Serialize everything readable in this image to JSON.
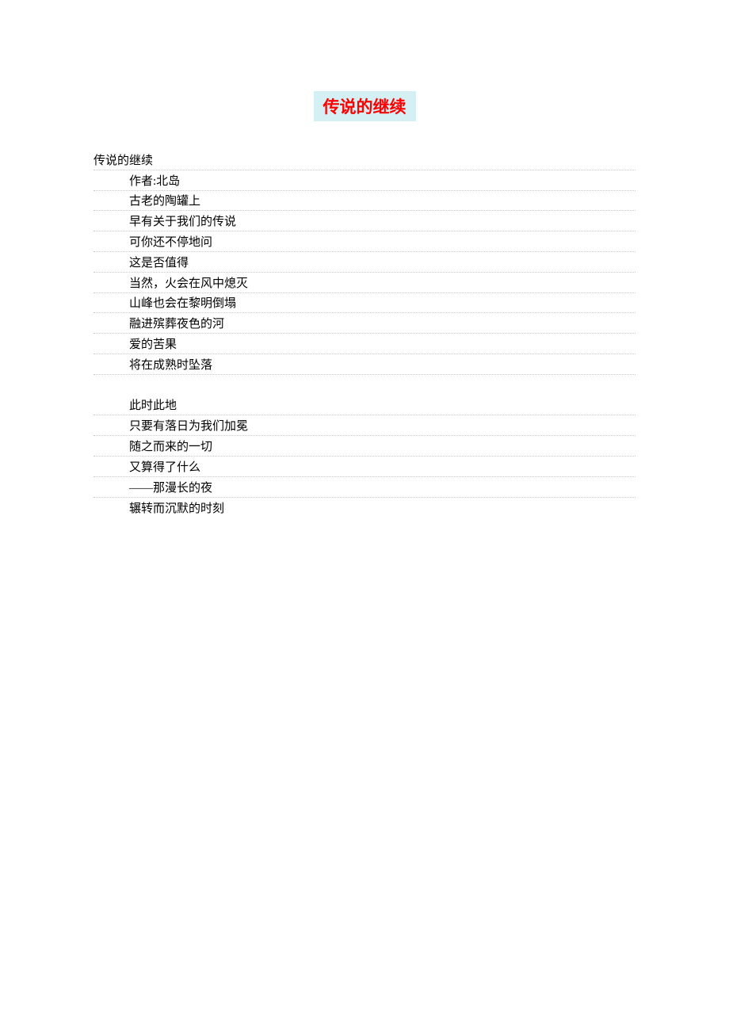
{
  "title": "传说的继续",
  "poem": {
    "title_line": "传说的继续",
    "author_line": "作者:北岛",
    "stanza1": [
      "古老的陶罐上",
      "早有关于我们的传说",
      "可你还不停地问",
      "这是否值得",
      "当然，火会在风中熄灭",
      "山峰也会在黎明倒塌",
      "融进殡葬夜色的河",
      "爱的苦果",
      "将在成熟时坠落"
    ],
    "stanza2": [
      "此时此地",
      "只要有落日为我们加冕",
      "随之而来的一切",
      "又算得了什么",
      "——那漫长的夜",
      "辗转而沉默的时刻"
    ]
  }
}
